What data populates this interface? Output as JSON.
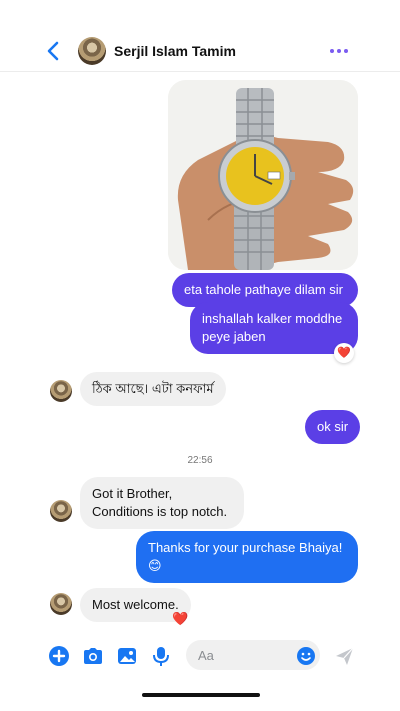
{
  "header": {
    "contact_name": "Serjil Islam Tamim",
    "back_icon": "chevron-left-icon",
    "more_icon": "more-dots-icon",
    "accent_color": "#7b5cf0"
  },
  "messages": [
    {
      "id": "m1",
      "type": "image",
      "from": "me",
      "description": "watch-photo"
    },
    {
      "id": "m2",
      "from": "me",
      "text": "eta tahole pathaye dilam sir"
    },
    {
      "id": "m3",
      "from": "me",
      "text": "inshallah kalker moddhe peye jaben",
      "reaction": "❤️"
    },
    {
      "id": "m4",
      "from": "them",
      "text": "ঠিক আছে। এটা কনফার্ম"
    },
    {
      "id": "m5",
      "from": "me",
      "text": "ok sir"
    },
    {
      "id": "m6",
      "from": "them",
      "text_line1": "Got it Brother,",
      "text_line2": "Conditions is top notch."
    },
    {
      "id": "m7",
      "from": "me",
      "text_line1": "Thanks for your purchase Bhaiya!",
      "emoji": "😊"
    },
    {
      "id": "m8",
      "from": "them",
      "text": "Most welcome.",
      "reaction": "❤️"
    }
  ],
  "timestamp": "22:56",
  "composer": {
    "placeholder": "Aa",
    "icons": [
      "plus-icon",
      "camera-icon",
      "gallery-icon",
      "microphone-icon",
      "emoji-icon",
      "send-icon"
    ]
  },
  "colors": {
    "outgoing_purple": "#5b3fe6",
    "outgoing_blue": "#1f6ff2",
    "incoming": "#f0f0f0",
    "icon_blue": "#1877f2",
    "heart": "#e41e3f"
  }
}
